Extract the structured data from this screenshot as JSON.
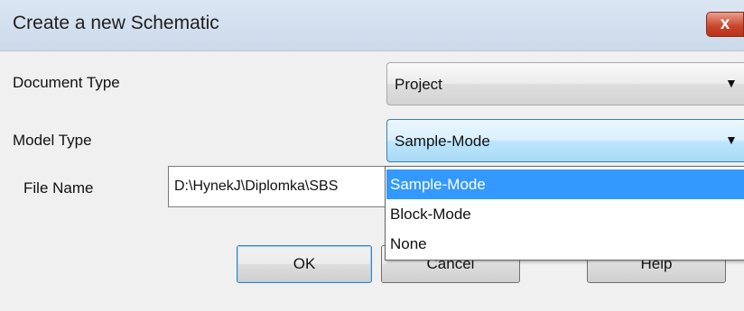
{
  "dialog": {
    "title": "Create a new Schematic",
    "close_label": "x"
  },
  "form": {
    "document_type": {
      "label": "Document Type",
      "value": "Project"
    },
    "model_type": {
      "label": "Model Type",
      "value": "Sample-Mode",
      "options": [
        "Sample-Mode",
        "Block-Mode",
        "None"
      ],
      "highlighted_index": 0
    },
    "file_name": {
      "label": "File Name",
      "value": "D:\\HynekJ\\Diplomka\\SBS"
    }
  },
  "buttons": {
    "ok": "OK",
    "cancel": "Cancel",
    "help": "Help"
  },
  "icons": {
    "close": "close-icon",
    "dropdown": "chevron-down-icon"
  },
  "colors": {
    "selection": "#3399ff",
    "close_button": "#c9432a",
    "titlebar": "#d3dfee",
    "focus_border": "#3c7fb1"
  }
}
